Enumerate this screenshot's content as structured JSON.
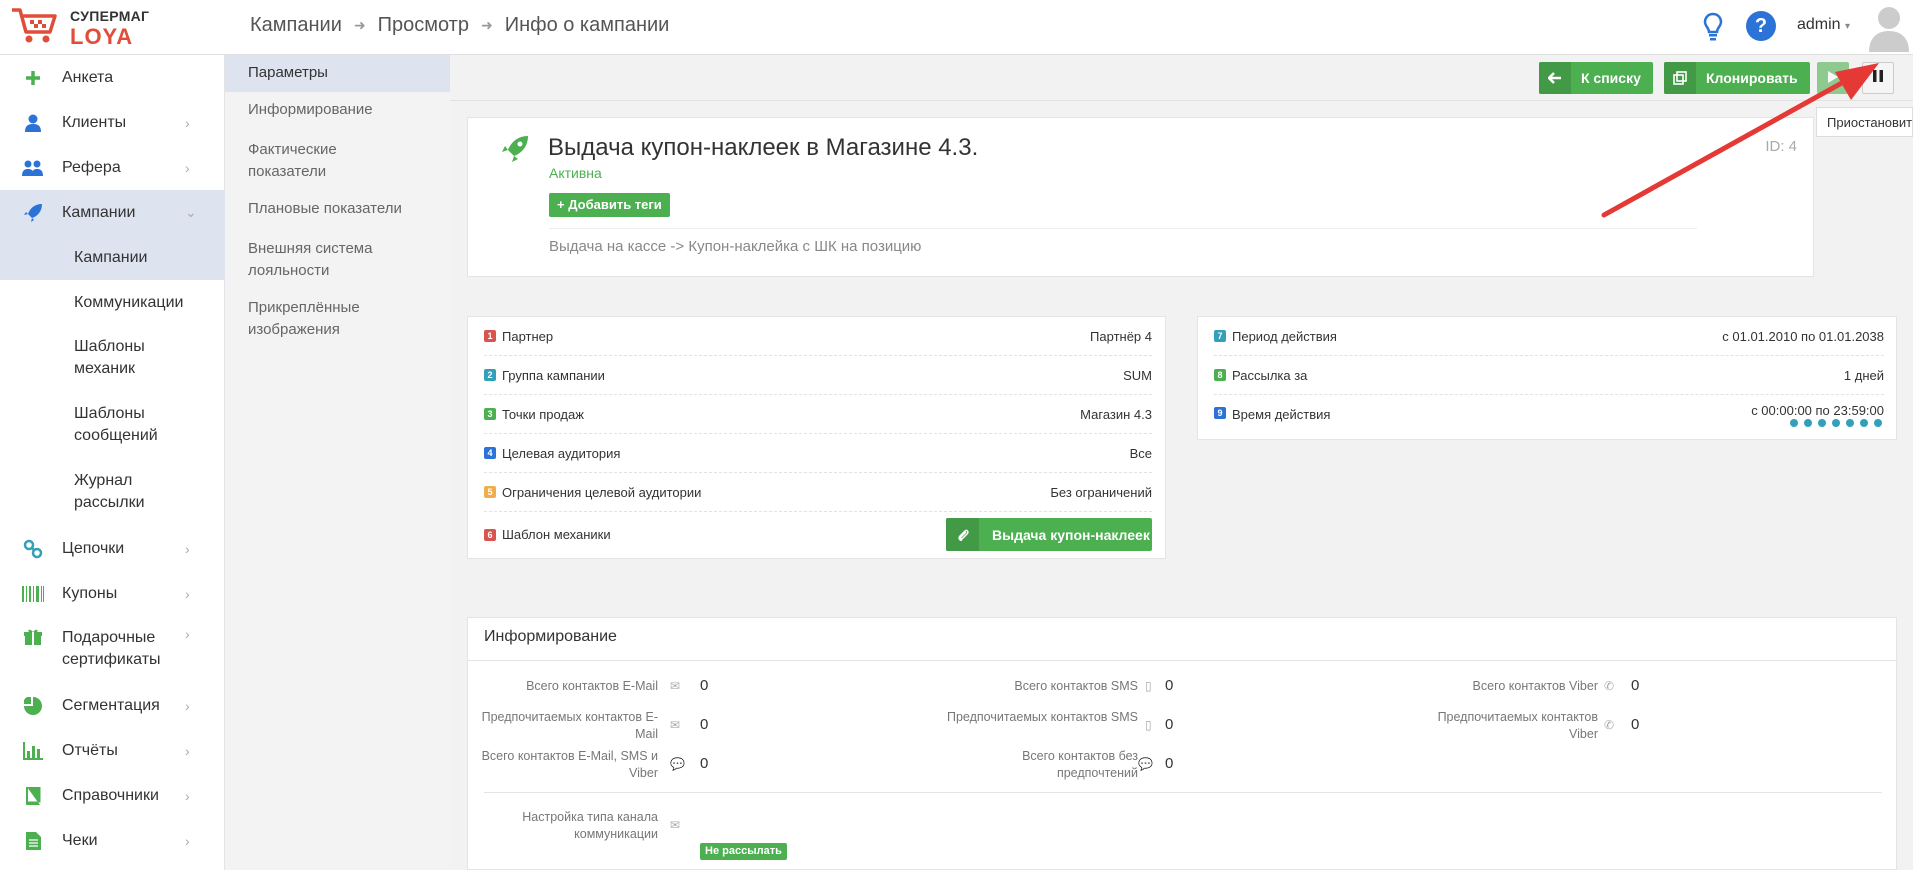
{
  "app": {
    "brand_top": "СУПЕРМАГ",
    "brand_bottom": "LOYA"
  },
  "breadcrumb": [
    "Кампании",
    "Просмотр",
    "Инфо о кампании"
  ],
  "header": {
    "user": "admin",
    "help_label": "?"
  },
  "sidebar": {
    "items": [
      {
        "label": "Анкета",
        "icon": "plus-icon",
        "chevron": false
      },
      {
        "label": "Клиенты",
        "icon": "user-icon",
        "chevron": true
      },
      {
        "label": "Рефера",
        "icon": "users-icon",
        "chevron": true
      },
      {
        "label": "Кампании",
        "icon": "rocket-icon",
        "chevron": true,
        "active": true
      },
      {
        "label": "Кампании",
        "sub": true,
        "active": true
      },
      {
        "label": "Коммуникации",
        "sub": true
      },
      {
        "label": "Шаблоны механик",
        "sub": true
      },
      {
        "label": "Шаблоны сообщений",
        "sub": true
      },
      {
        "label": "Журнал рассылки",
        "sub": true
      },
      {
        "label": "Цепочки",
        "icon": "chain-icon",
        "chevron": true
      },
      {
        "label": "Купоны",
        "icon": "barcode-icon",
        "chevron": true
      },
      {
        "label": "Подарочные сертификаты",
        "icon": "gift-icon",
        "chevron": true
      },
      {
        "label": "Сегментация",
        "icon": "pie-icon",
        "chevron": true
      },
      {
        "label": "Отчёты",
        "icon": "bar-chart-icon",
        "chevron": true
      },
      {
        "label": "Справочники",
        "icon": "book-icon",
        "chevron": true
      },
      {
        "label": "Чеки",
        "icon": "receipt-icon",
        "chevron": true
      }
    ]
  },
  "subnav": {
    "items": [
      "Параметры",
      "Информирование",
      "Фактические показатели",
      "Плановые показатели",
      "Внешняя система лояльности",
      "Прикреплённые изображения"
    ]
  },
  "actions": {
    "to_list": "К списку",
    "clone": "Клонировать",
    "pause_tooltip": "Приостановить"
  },
  "campaign": {
    "title": "Выдача купон-наклеек в Магазине 4.3.",
    "status": "Активна",
    "id": "ID: 4",
    "add_tags": "Добавить теги",
    "description": "Выдача на кассе -> Купон-наклейка с ШК на позицию"
  },
  "params_left": [
    {
      "num": "1",
      "color": "#d9534f",
      "label": "Партнер",
      "value": "Партнёр 4"
    },
    {
      "num": "2",
      "color": "#31a0b8",
      "label": "Группа кампании",
      "value": "SUM"
    },
    {
      "num": "3",
      "color": "#4caf50",
      "label": "Точки продаж",
      "value": "Магазин 4.3"
    },
    {
      "num": "4",
      "color": "#2b73d6",
      "label": "Целевая аудитория",
      "value": "Все"
    },
    {
      "num": "5",
      "color": "#f0ad4e",
      "label": "Ограничения целевой аудитории",
      "value": "Без ограничений"
    },
    {
      "num": "6",
      "color": "#d9534f",
      "label": "Шаблон механики",
      "value": "Выдача купон-наклеек"
    }
  ],
  "params_right": [
    {
      "num": "7",
      "color": "#31a0b8",
      "label": "Период действия",
      "value": "с 01.01.2010 по 01.01.2038"
    },
    {
      "num": "8",
      "color": "#4caf50",
      "label": "Рассылка за",
      "value": "1 дней"
    },
    {
      "num": "9",
      "color": "#2b73d6",
      "label": "Время действия",
      "value": "с 00:00:00 по 23:59:00"
    }
  ],
  "informing": {
    "title": "Информирование",
    "stats": [
      {
        "label": "Всего контактов E-Mail",
        "value": "0",
        "icon": "mail-icon"
      },
      {
        "label": "Предпочитаемых контактов E-Mail",
        "value": "0",
        "icon": "mail-icon"
      },
      {
        "label": "Всего контактов E-Mail, SMS и Viber",
        "value": "0",
        "icon": "chat-icon"
      },
      {
        "label": "Всего контактов SMS",
        "value": "0",
        "icon": "phone-icon"
      },
      {
        "label": "Предпочитаемых контактов SMS",
        "value": "0",
        "icon": "phone-icon"
      },
      {
        "label": "Всего контактов без предпочтений",
        "value": "0",
        "icon": "chat-icon"
      },
      {
        "label": "Всего контактов Viber",
        "value": "0",
        "icon": "viber-icon"
      },
      {
        "label": "Предпочитаемых контактов Viber",
        "value": "0",
        "icon": "viber-icon"
      }
    ],
    "channel_label": "Настройка типа канала коммуникации",
    "channel_value": "Не рассылать"
  }
}
